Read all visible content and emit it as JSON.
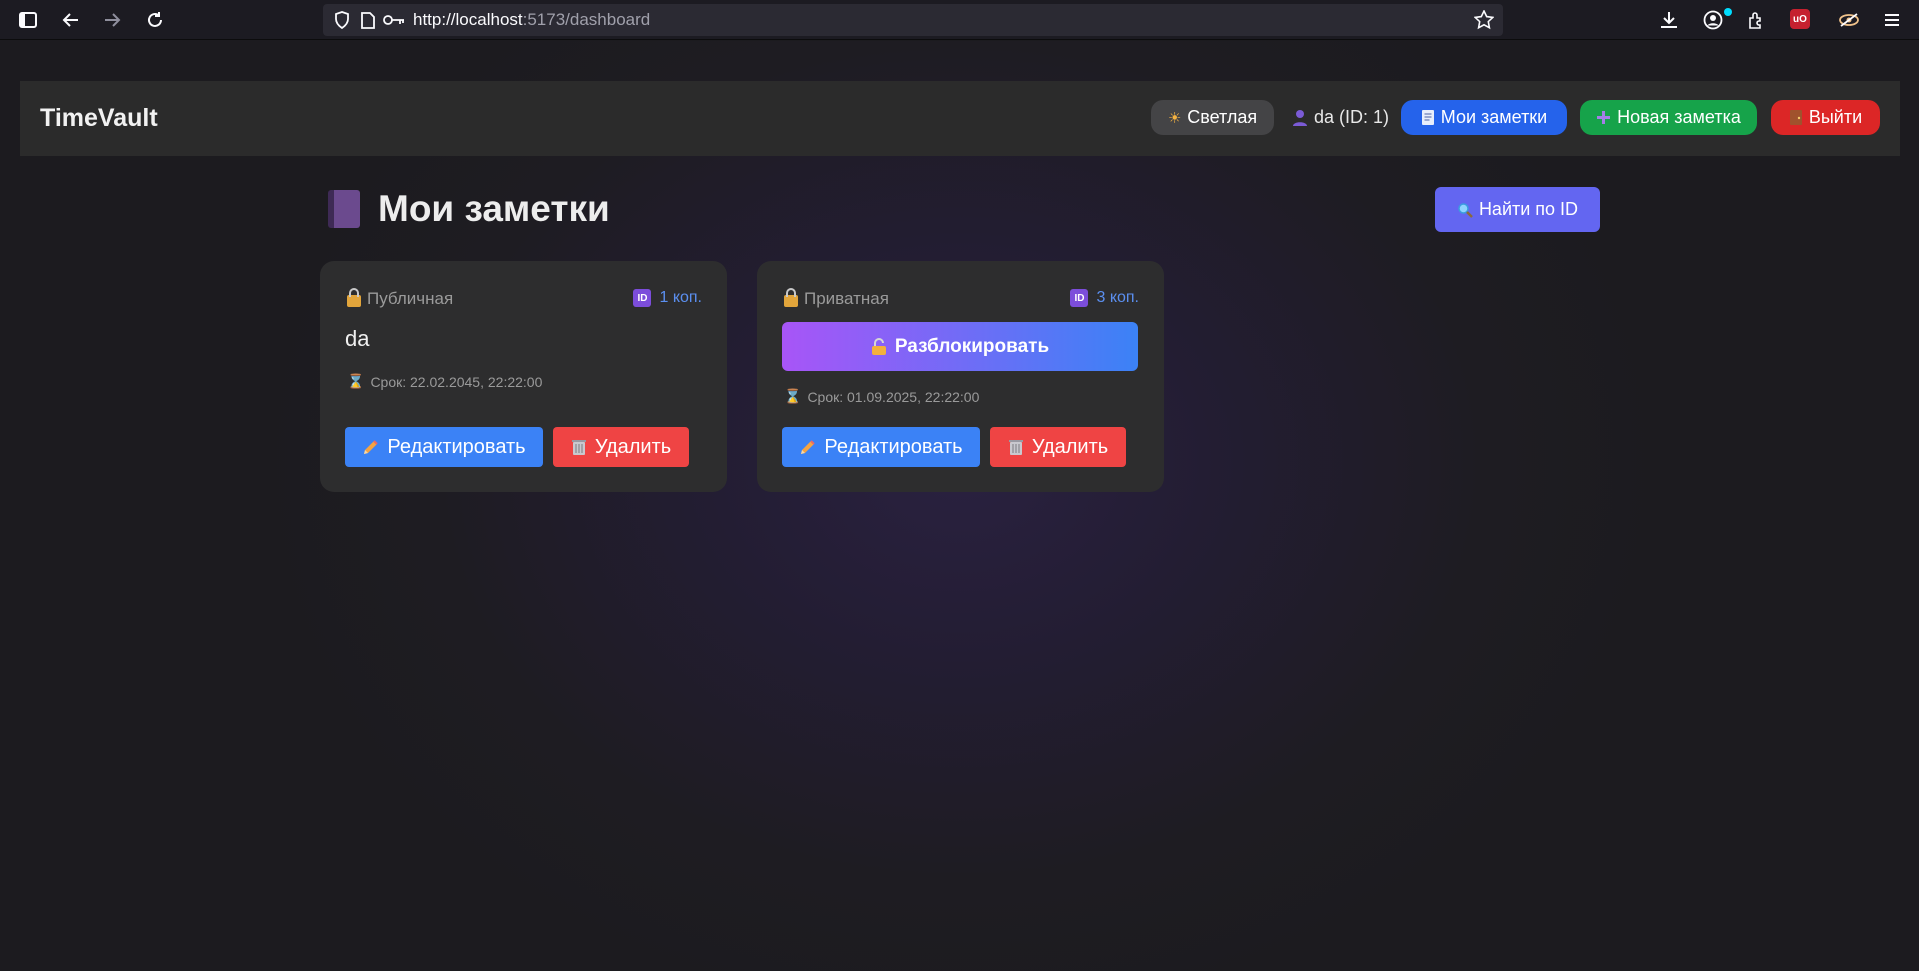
{
  "browser": {
    "url_host": "http://localhost",
    "url_rest": ":5173/dashboard"
  },
  "header": {
    "logo": "TimeVault",
    "theme_label": "Светлая",
    "user_label": "da (ID: 1)",
    "my_notes_label": "Мои заметки",
    "new_note_label": "Новая заметка",
    "logout_label": "Выйти"
  },
  "main": {
    "title": "Мои заметки",
    "find_label": "Найти по ID"
  },
  "notes": [
    {
      "visibility": "Публичная",
      "copies": "1 коп.",
      "text": "da",
      "deadline": "Срок: 22.02.2045, 22:22:00",
      "edit_label": "Редактировать",
      "delete_label": "Удалить"
    },
    {
      "visibility": "Приватная",
      "copies": "3 коп.",
      "unlock_label": "Разблокировать",
      "deadline": "Срок: 01.09.2025, 22:22:00",
      "edit_label": "Редактировать",
      "delete_label": "Удалить"
    }
  ],
  "colors": {
    "accent_blue": "#3b82f6",
    "danger_red": "#ef4444",
    "success_green": "#16a34a",
    "find_indigo": "#6366f1"
  },
  "icons": {
    "theme": "sun-icon",
    "user": "user-icon",
    "my_notes": "notebook-icon",
    "new_note": "plus-icon",
    "logout": "door-icon",
    "find": "magnifier-icon",
    "lock": "lock-icon",
    "unlock": "unlock-icon",
    "edit": "pencil-icon",
    "delete": "trash-icon",
    "deadline": "hourglass-icon"
  }
}
